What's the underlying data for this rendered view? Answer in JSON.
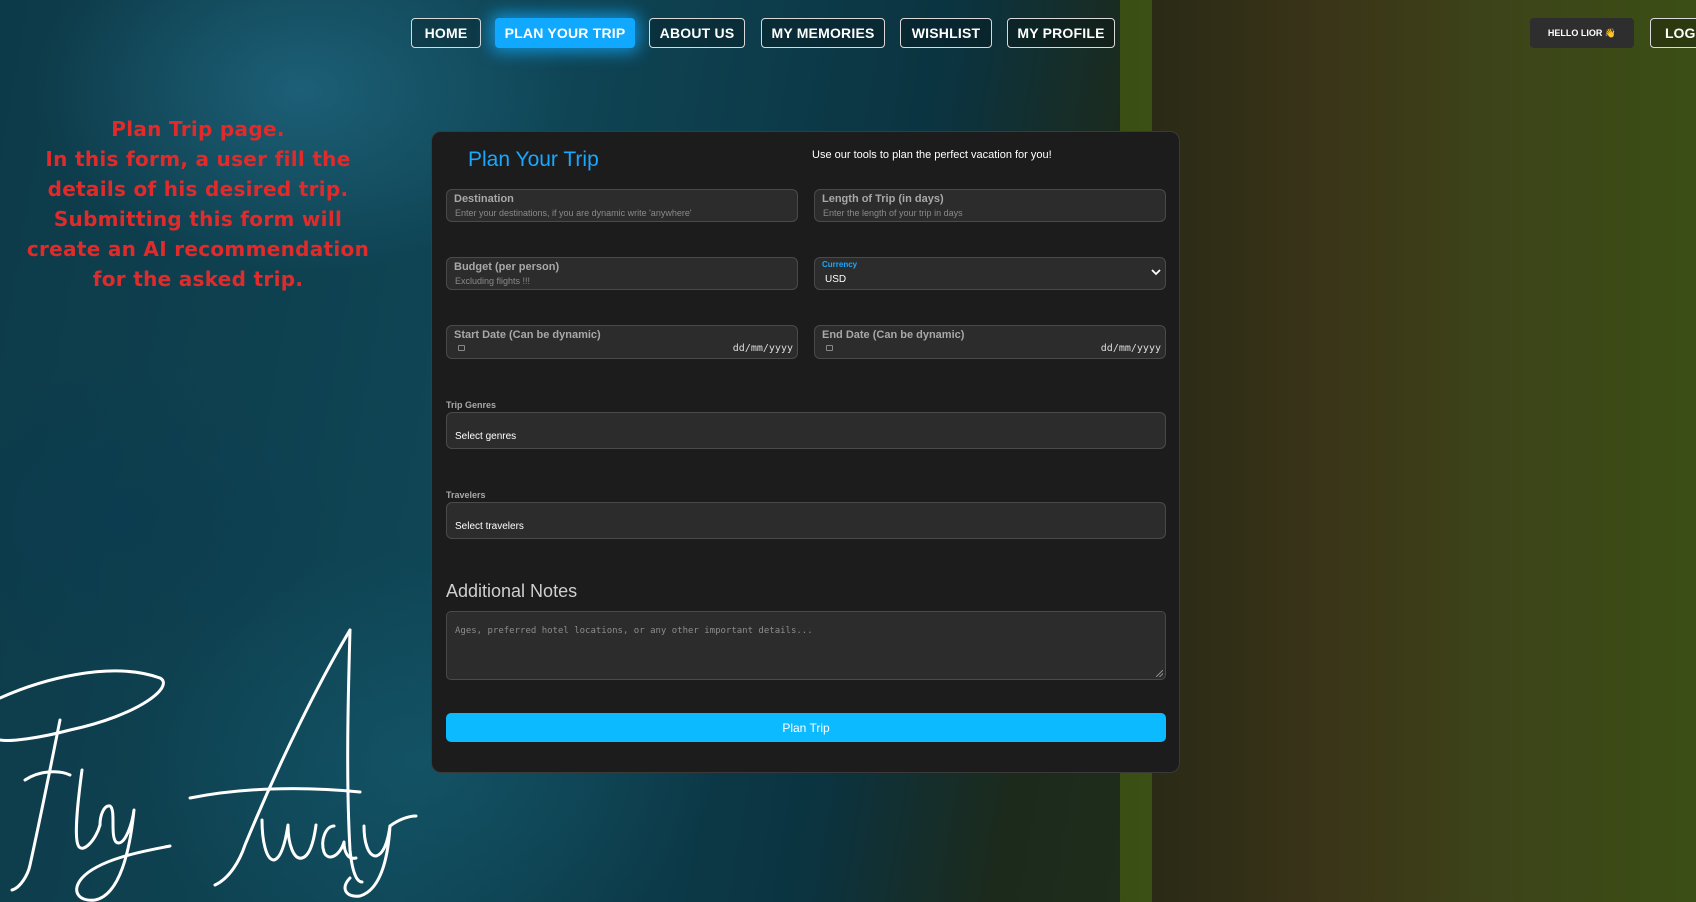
{
  "nav": {
    "items": [
      {
        "label": "HOME"
      },
      {
        "label": "PLAN YOUR TRIP",
        "active": true
      },
      {
        "label": "ABOUT US"
      },
      {
        "label": "MY MEMORIES"
      },
      {
        "label": "WISHLIST"
      },
      {
        "label": "MY PROFILE"
      }
    ],
    "hello_label": "HELLO LIOR 👋",
    "logout_label": "LOGO"
  },
  "annotation": {
    "lines": [
      "Plan Trip page.",
      "In this form, a user fill the",
      "details of his desired trip.",
      "Submitting this form will",
      "create an AI recommendation",
      "for the asked trip."
    ],
    "color": "#e12a2a"
  },
  "brand": {
    "signature_text": "Fly Away"
  },
  "form": {
    "title": "Plan Your Trip",
    "subtitle": "Use our tools to plan the perfect vacation for you!",
    "destination": {
      "label": "Destination",
      "placeholder": "Enter your destinations, if you are dynamic write 'anywhere'"
    },
    "length": {
      "label": "Length of Trip (in days)",
      "placeholder": "Enter the length of your trip in days"
    },
    "budget": {
      "label": "Budget (per person)",
      "placeholder": "Excluding flights !!!"
    },
    "currency": {
      "label": "Currency",
      "value": "USD"
    },
    "start_date": {
      "label": "Start Date (Can be dynamic)",
      "format": "dd/mm/yyyy"
    },
    "end_date": {
      "label": "End Date (Can be dynamic)",
      "format": "dd/mm/yyyy"
    },
    "genres": {
      "label": "Trip Genres",
      "value": "Select genres"
    },
    "travelers": {
      "label": "Travelers",
      "value": "Select travelers"
    },
    "notes": {
      "title": "Additional Notes",
      "placeholder": "Ages, preferred hotel locations, or any other important details..."
    },
    "submit_label": "Plan Trip"
  },
  "colors": {
    "accent": "#18a8ff",
    "submit": "#0cbaff",
    "panel": "#1c1c1c"
  }
}
